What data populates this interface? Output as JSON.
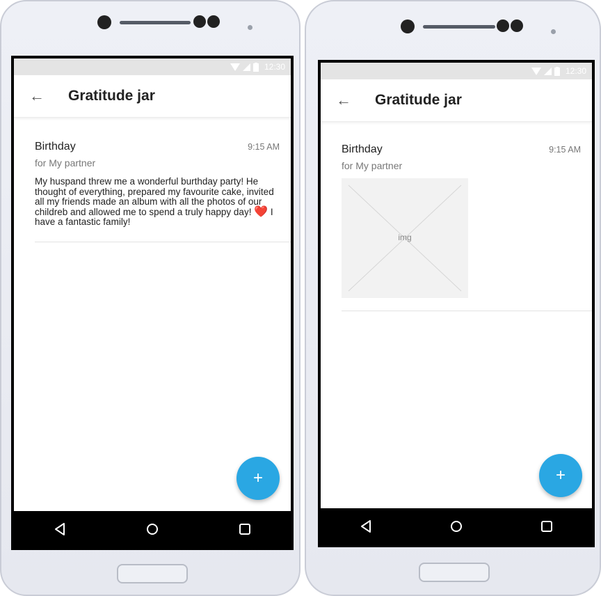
{
  "screens": [
    {
      "status_time": "12:30",
      "app_title": "Gratitude jar",
      "entry": {
        "title": "Birthday",
        "time": "9:15 AM",
        "for": "for My partner",
        "body_before_heart": "My huspand threw me a wonderful burthday party! He thought of everything, prepared my favourite cake, invited all my friends made an album with all the photos of our childreb and allowed me to spend a truly happy day!",
        "heart": "❤️",
        "body_after_heart": "I have a fantastic family!"
      },
      "fab_label": "+"
    },
    {
      "status_time": "12:30",
      "app_title": "Gratitude jar",
      "entry": {
        "title": "Birthday",
        "time": "9:15 AM",
        "for": "for My partner",
        "image_label": "img"
      },
      "fab_label": "+"
    }
  ],
  "colors": {
    "fab": "#2aa7e3",
    "heart": "#e8342f",
    "navbar": "#000000",
    "statusbar": "#e4e4e4"
  },
  "icons": {
    "back": "arrow-left-icon",
    "add": "plus-icon",
    "nav_back": "triangle-back-icon",
    "nav_home": "circle-home-icon",
    "nav_recents": "square-recents-icon"
  }
}
